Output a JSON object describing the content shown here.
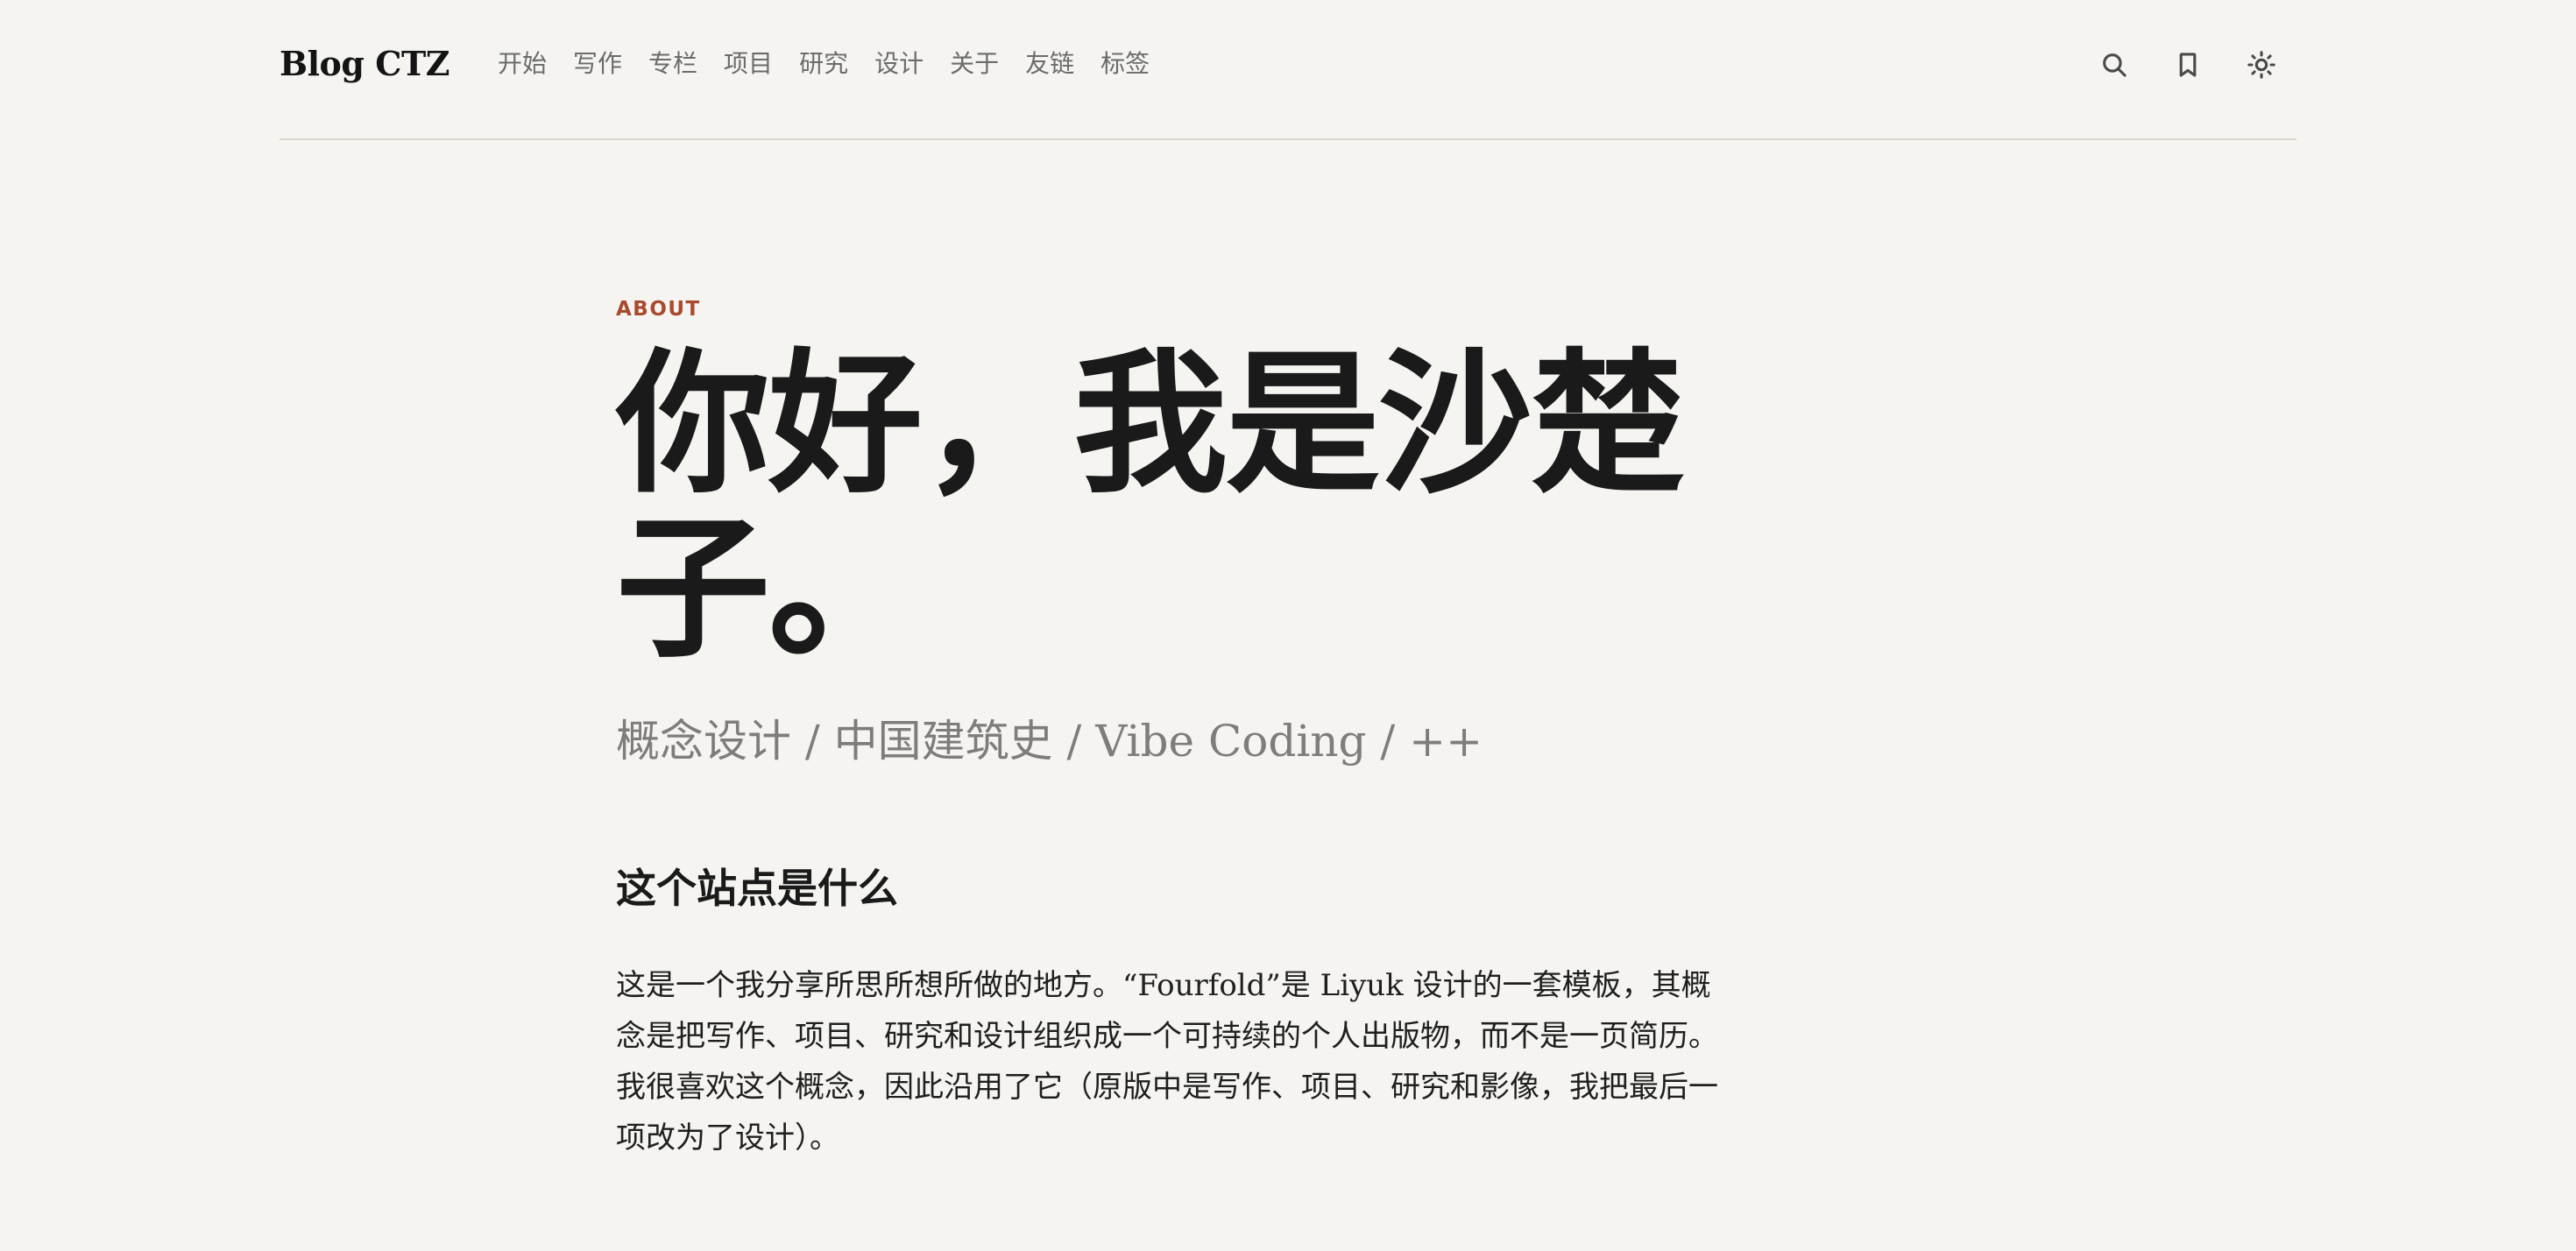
{
  "header": {
    "brand": "Blog CTZ",
    "nav": [
      "开始",
      "写作",
      "专栏",
      "项目",
      "研究",
      "设计",
      "关于",
      "友链",
      "标签"
    ],
    "icons": [
      "search-icon",
      "bookmark-icon",
      "sun-icon"
    ]
  },
  "main": {
    "eyebrow": "ABOUT",
    "title": "你好，我是沙楚子。",
    "subtitle": "概念设计 / 中国建筑史 / Vibe Coding / ++",
    "section_heading": "这个站点是什么",
    "paragraph": "这是一个我分享所思所想所做的地方。“Fourfold”是 Liyuk 设计的一套模板，其概念是把写作、项目、研究和设计组织成一个可持续的个人出版物，而不是一页简历。我很喜欢这个概念，因此沿用了它（原版中是写作、项目、研究和影像，我把最后一项改为了设计）。"
  },
  "colors": {
    "background": "#f5f4f1",
    "accent": "#a84a2e",
    "text": "#1a1a1a",
    "muted": "#7e7d7a"
  }
}
